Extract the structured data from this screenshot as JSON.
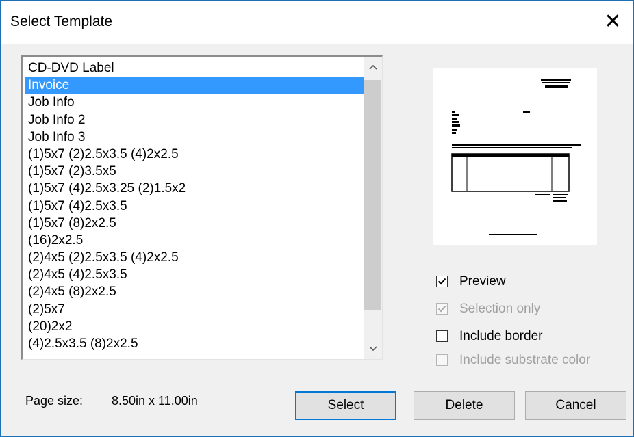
{
  "dialog": {
    "title": "Select Template"
  },
  "list": {
    "items": [
      "CD-DVD Label",
      "Invoice",
      "Job Info",
      "Job Info 2",
      "Job Info 3",
      "(1)5x7 (2)2.5x3.5 (4)2x2.5",
      "(1)5x7 (2)3.5x5",
      "(1)5x7 (4)2.5x3.25 (2)1.5x2",
      "(1)5x7 (4)2.5x3.5",
      "(1)5x7 (8)2x2.5",
      "(16)2x2.5",
      "(2)4x5 (2)2.5x3.5 (4)2x2.5",
      "(2)4x5 (4)2.5x3.5",
      "(2)4x5 (8)2x2.5",
      "(2)5x7",
      "(20)2x2",
      "(4)2.5x3.5 (8)2x2.5"
    ],
    "selected": "Invoice",
    "scroll_up_icon": "chevron-up",
    "scroll_down_icon": "chevron-down"
  },
  "options": {
    "preview": {
      "label": "Preview",
      "checked": true,
      "enabled": true
    },
    "selection_only": {
      "label": "Selection only",
      "checked": true,
      "enabled": false
    },
    "include_border": {
      "label": "Include border",
      "checked": false,
      "enabled": true
    },
    "include_substrate_color": {
      "label": "Include substrate color",
      "checked": false,
      "enabled": false
    }
  },
  "footer": {
    "page_size_label": "Page size:",
    "page_size_value": "8.50in x 11.00in"
  },
  "buttons": {
    "select": "Select",
    "delete": "Delete",
    "cancel": "Cancel"
  },
  "colors": {
    "selection": "#3399ff",
    "default_button_border": "#0078d7",
    "window_border": "#1f6fb5"
  }
}
